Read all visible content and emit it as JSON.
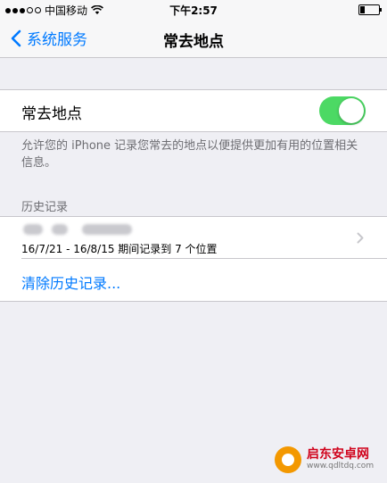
{
  "status_bar": {
    "carrier": "中国移动",
    "time": "下午2:57"
  },
  "nav": {
    "back_label": "系统服务",
    "title": "常去地点"
  },
  "toggle_row": {
    "label": "常去地点",
    "enabled": true
  },
  "footer_note": "允许您的 iPhone 记录您常去的地点以便提供更加有用的位置相关信息。",
  "history": {
    "section_title": "历史记录",
    "entry_text": "16/7/21 - 16/8/15 期间记录到 7 个位置",
    "clear_label": "清除历史记录..."
  },
  "watermark": {
    "name": "启东安卓网",
    "url": "www.qdltdq.com"
  },
  "colors": {
    "accent": "#007aff",
    "switch_on": "#4cd964",
    "background": "#efeff4"
  }
}
